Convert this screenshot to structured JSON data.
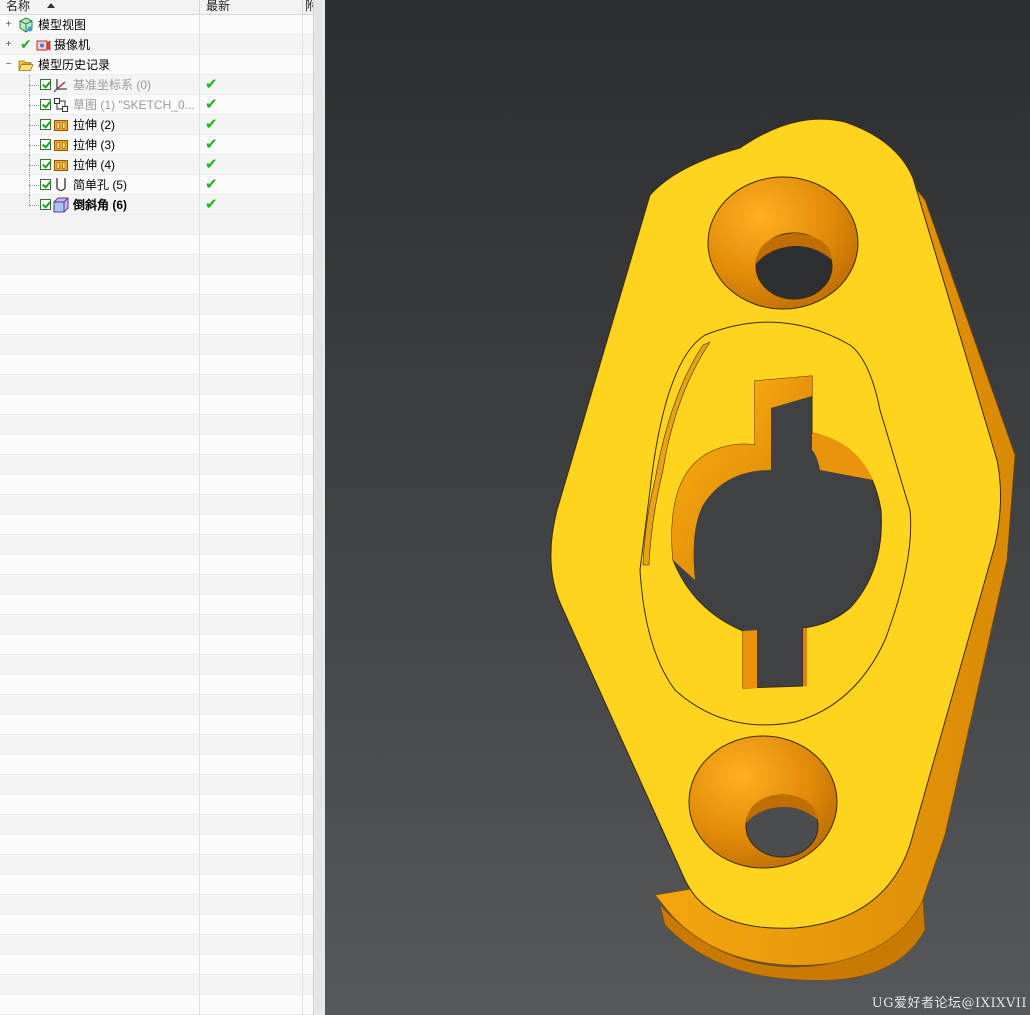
{
  "navigator": {
    "columns": {
      "name": "名称",
      "latest": "最新",
      "third": "附"
    },
    "items": [
      {
        "label": "模型视图",
        "icon": "model-views-icon",
        "level": 0,
        "expander": "+"
      },
      {
        "label": "摄像机",
        "icon": "cameras-icon",
        "level": 0,
        "expander": "+"
      },
      {
        "label": "模型历史记录",
        "icon": "folder-open-icon",
        "level": 0,
        "expander": "−"
      },
      {
        "label": "基准坐标系 (0)",
        "icon": "datum-csys-icon",
        "level": 1,
        "checked": true,
        "latest": "✔",
        "style": "gray"
      },
      {
        "label": "草图 (1) \"SKETCH_0...",
        "icon": "sketch-icon",
        "level": 1,
        "checked": true,
        "latest": "✔",
        "style": "gray"
      },
      {
        "label": "拉伸 (2)",
        "icon": "extrude-icon",
        "level": 1,
        "checked": true,
        "latest": "✔"
      },
      {
        "label": "拉伸 (3)",
        "icon": "extrude-icon",
        "level": 1,
        "checked": true,
        "latest": "✔"
      },
      {
        "label": "拉伸 (4)",
        "icon": "extrude-icon",
        "level": 1,
        "checked": true,
        "latest": "✔"
      },
      {
        "label": "简单孔 (5)",
        "icon": "simple-hole-icon",
        "level": 1,
        "checked": true,
        "latest": "✔"
      },
      {
        "label": "倒斜角 (6)",
        "icon": "chamfer-icon",
        "level": 1,
        "checked": true,
        "latest": "✔",
        "style": "bold"
      }
    ]
  },
  "viewport": {
    "watermark": "UG爱好者论坛@IXIXVII",
    "model_color": "#ffd21f",
    "model_side_color": "#e89a06",
    "background_top": "#2b2d30",
    "background_bottom": "#56585c"
  }
}
